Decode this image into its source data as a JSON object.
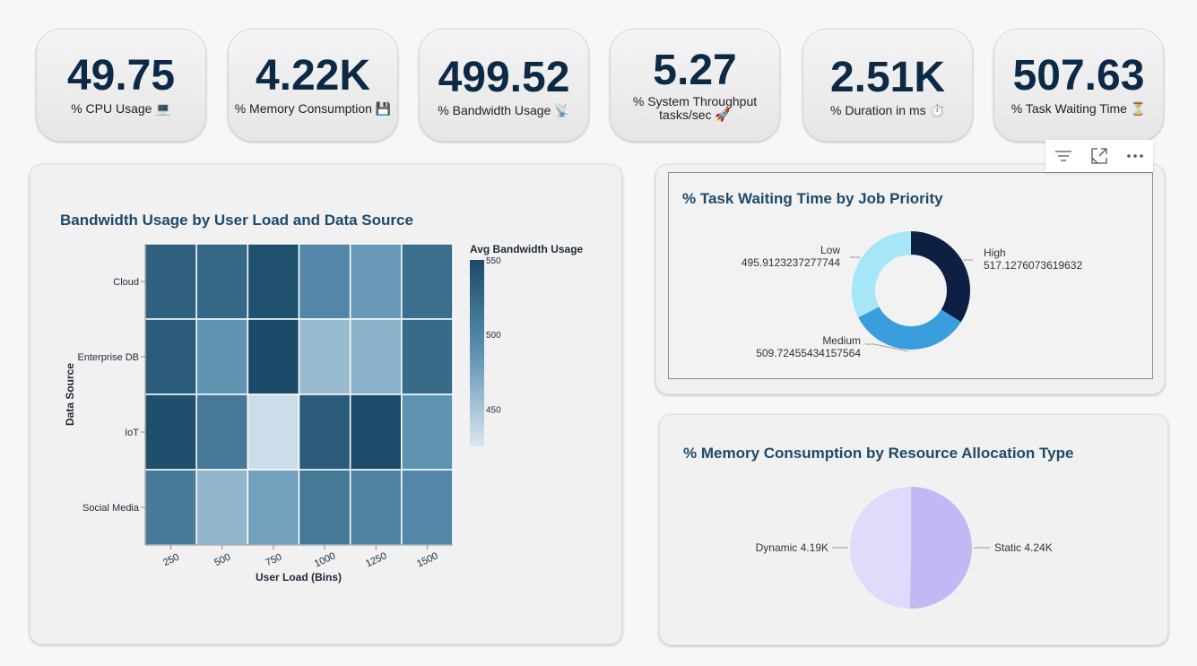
{
  "kpis": [
    {
      "value": "49.75",
      "label": "% CPU Usage 💻"
    },
    {
      "value": "4.22K",
      "label": "% Memory Consumption 💾"
    },
    {
      "value": "499.52",
      "label": "% Bandwidth Usage 📡"
    },
    {
      "value": "5.27",
      "label": "% System Throughput",
      "label2": "tasks/sec 🚀"
    },
    {
      "value": "2.51K",
      "label": "% Duration in ms ⏱️"
    },
    {
      "value": "507.63",
      "label": "% Task Waiting Time ⏳"
    }
  ],
  "heatmap": {
    "title": "Bandwidth Usage by User Load and Data Source",
    "xlabel": "User Load (Bins)",
    "ylabel": "Data Source",
    "legend_title": "Avg Bandwidth Usage"
  },
  "donut": {
    "title": "% Task Waiting Time by Job Priority"
  },
  "pie": {
    "title": "% Memory Consumption by Resource Allocation Type"
  },
  "chart_data": [
    {
      "type": "heatmap",
      "title": "Bandwidth Usage by User Load and Data Source",
      "xlabel": "User Load (Bins)",
      "ylabel": "Data Source",
      "x": [
        "250",
        "500",
        "750",
        "1000",
        "1250",
        "1500"
      ],
      "y": [
        "Cloud",
        "Enterprise DB",
        "IoT",
        "Social Media"
      ],
      "values": [
        [
          530,
          525,
          545,
          497,
          482,
          520
        ],
        [
          535,
          487,
          549,
          458,
          465,
          522
        ],
        [
          546,
          510,
          432,
          535,
          548,
          487
        ],
        [
          508,
          461,
          477,
          510,
          500,
          497
        ]
      ],
      "legend": {
        "title": "Avg Bandwidth Usage",
        "range": [
          425,
          550
        ],
        "ticks": [
          450,
          500,
          550
        ]
      }
    },
    {
      "type": "pie",
      "title": "% Task Waiting Time by Job Priority",
      "donut": true,
      "categories": [
        "High",
        "Medium",
        "Low"
      ],
      "values": [
        517.1276073619632,
        509.72455434157564,
        495.9123237277744
      ],
      "labels": [
        "517.1276073619632",
        "509.72455434157564",
        "495.9123237277744"
      ],
      "colors": [
        "#0e1f44",
        "#3a9ddc",
        "#a5e6f7"
      ]
    },
    {
      "type": "pie",
      "title": "% Memory Consumption by Resource Allocation Type",
      "categories": [
        "Static",
        "Dynamic"
      ],
      "values": [
        4240,
        4190
      ],
      "labels": [
        "Static 4.24K",
        "Dynamic 4.19K"
      ],
      "colors": [
        "#c2b8f3",
        "#e0dbfb"
      ]
    }
  ],
  "toolbar": {
    "icons": [
      "filter-icon",
      "focus-mode-icon",
      "more-options-icon"
    ]
  }
}
